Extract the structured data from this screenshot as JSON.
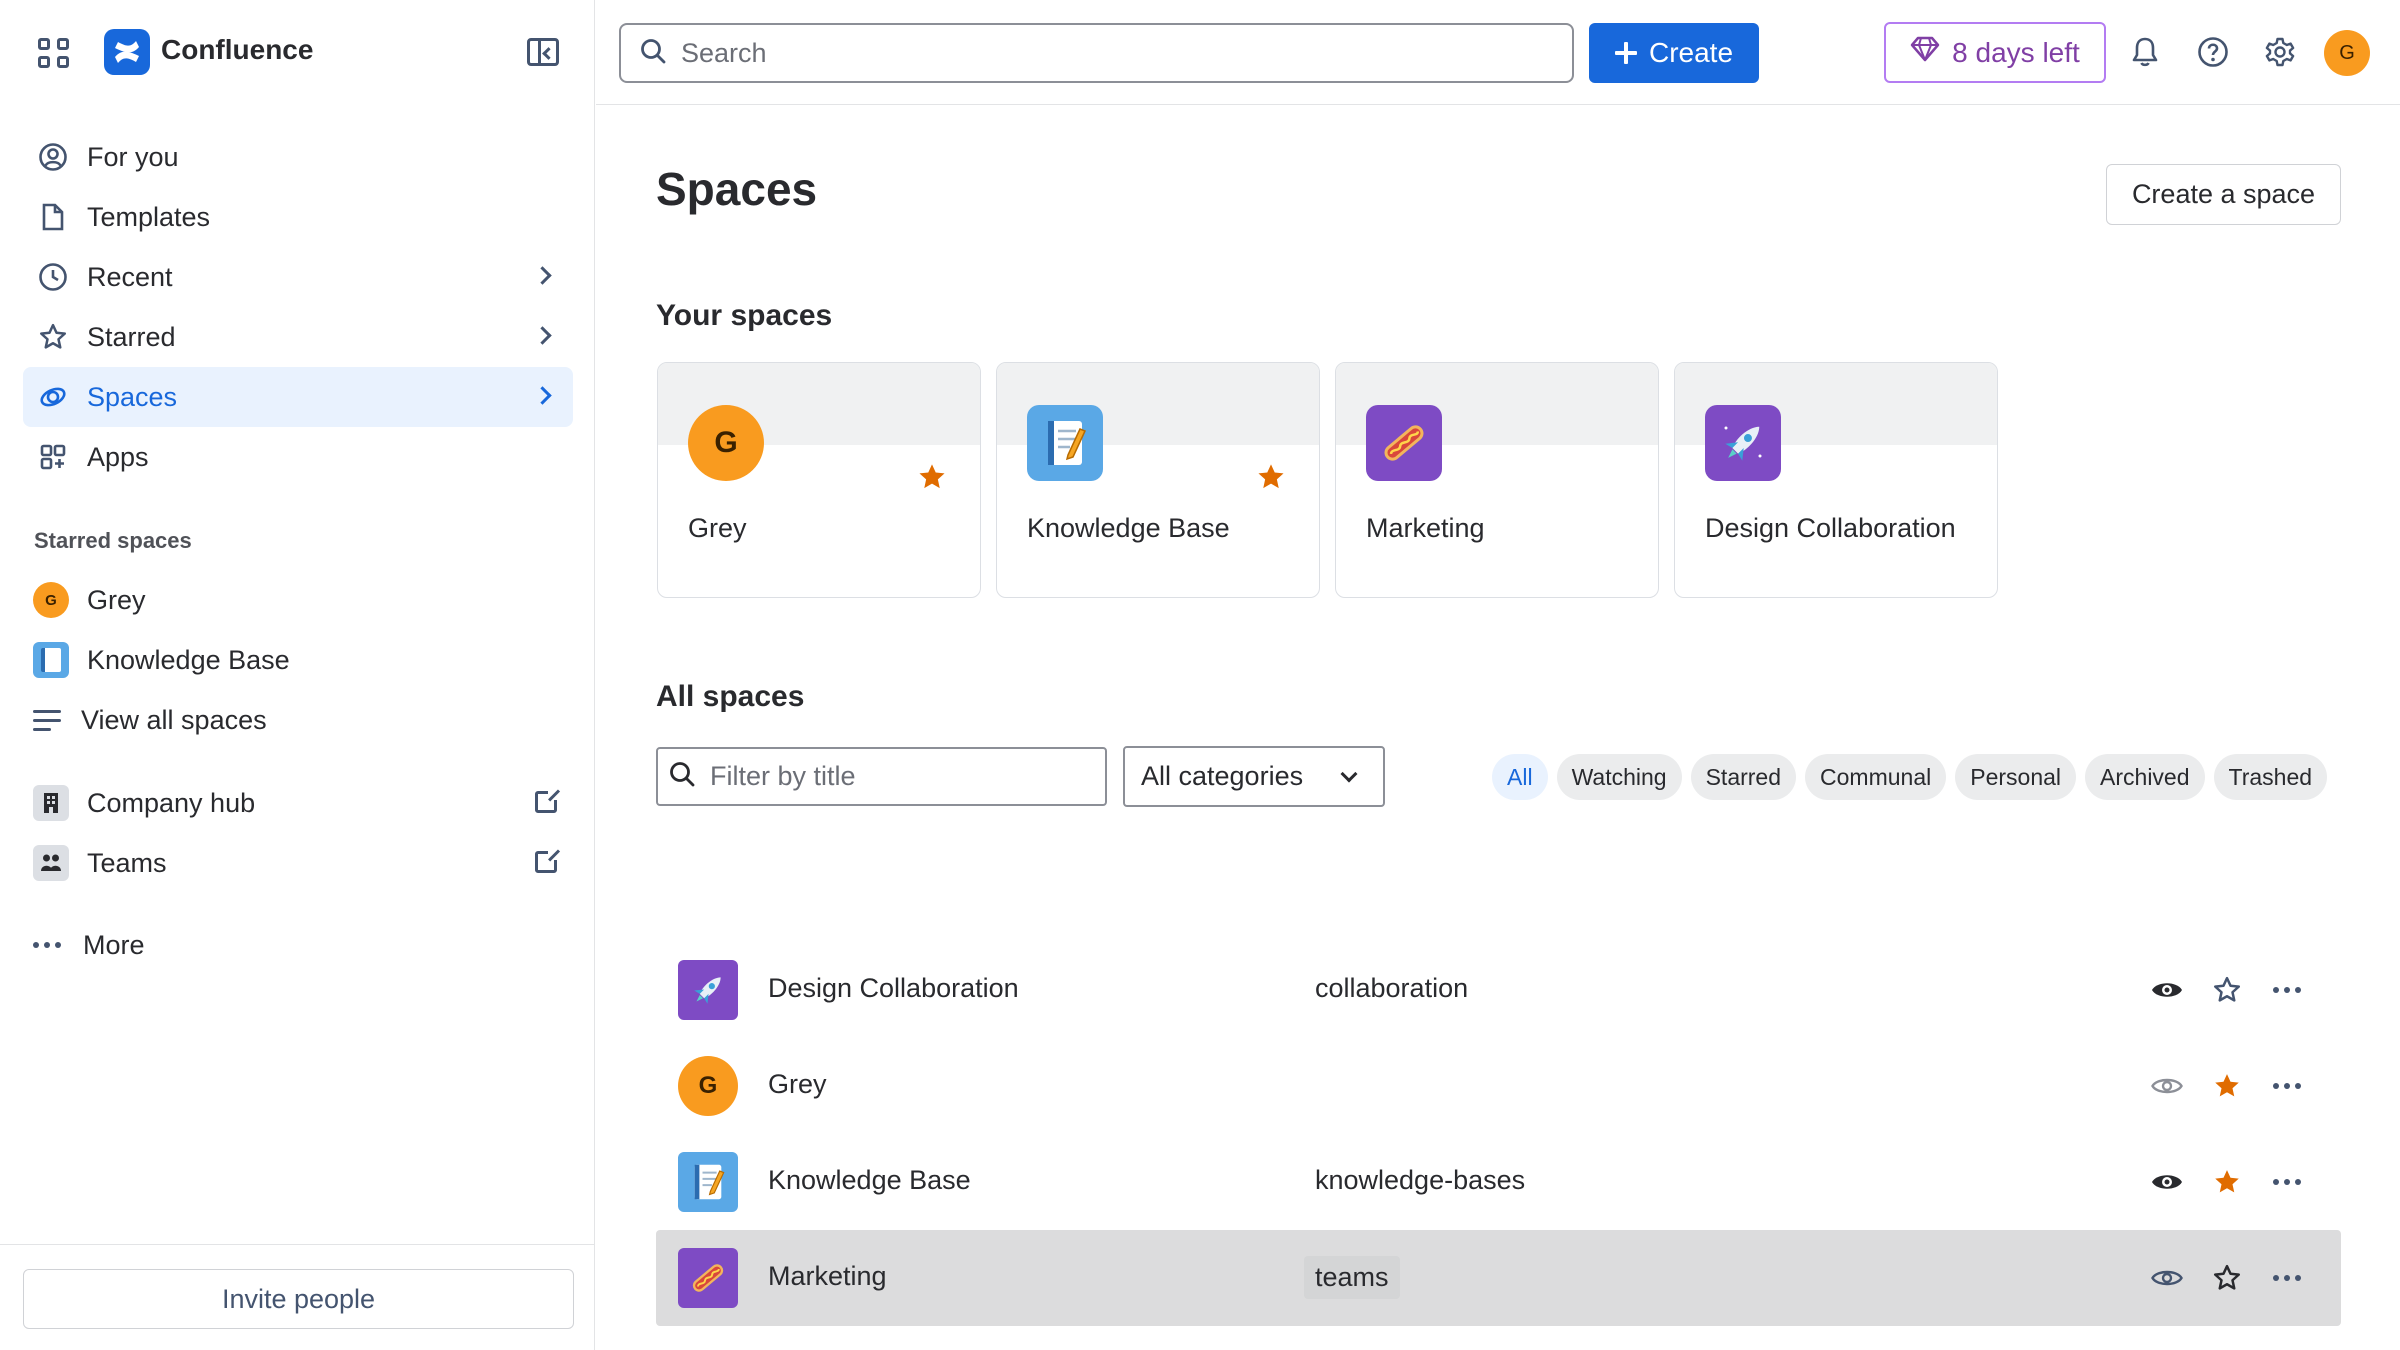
{
  "app": {
    "name": "Confluence"
  },
  "sidebar": {
    "nav": [
      {
        "label": "For you",
        "icon": "person-circle-icon"
      },
      {
        "label": "Templates",
        "icon": "templates-icon"
      },
      {
        "label": "Recent",
        "icon": "clock-icon",
        "has_chevron": true
      },
      {
        "label": "Starred",
        "icon": "star-outline-icon",
        "has_chevron": true
      },
      {
        "label": "Spaces",
        "icon": "spaces-icon",
        "has_chevron": true,
        "active": true
      },
      {
        "label": "Apps",
        "icon": "apps-icon"
      }
    ],
    "starred_label": "Starred spaces",
    "starred": [
      {
        "label": "Grey",
        "avatar_letter": "G"
      },
      {
        "label": "Knowledge Base"
      },
      {
        "label": "View all spaces"
      }
    ],
    "external": [
      {
        "label": "Company hub",
        "icon": "building-icon"
      },
      {
        "label": "Teams",
        "icon": "people-icon"
      }
    ],
    "more_label": "More",
    "invite_label": "Invite people"
  },
  "topbar": {
    "search_placeholder": "Search",
    "create_label": "Create",
    "trial_label": "8 days left",
    "user_initial": "G"
  },
  "main": {
    "title": "Spaces",
    "create_space_label": "Create a space",
    "your_spaces_heading": "Your spaces",
    "your_spaces": [
      {
        "name": "Grey",
        "icon": "avatar",
        "letter": "G",
        "starred": true
      },
      {
        "name": "Knowledge Base",
        "icon": "notebook-icon",
        "starred": true
      },
      {
        "name": "Marketing",
        "icon": "hotdog-icon",
        "starred": false
      },
      {
        "name": "Design Collaboration",
        "icon": "rocket-icon",
        "starred": false
      }
    ],
    "all_spaces_heading": "All spaces",
    "filter_placeholder": "Filter by title",
    "category_selected": "All categories",
    "chips": [
      "All",
      "Watching",
      "Starred",
      "Communal",
      "Personal",
      "Archived",
      "Trashed"
    ],
    "active_chip": "All",
    "rows": [
      {
        "name": "Design Collaboration",
        "key": "collaboration",
        "icon": "rocket-icon",
        "watching": true,
        "starred": false
      },
      {
        "name": "Grey",
        "key": "",
        "icon": "avatar",
        "letter": "G",
        "watching": false,
        "starred": true
      },
      {
        "name": "Knowledge Base",
        "key": "knowledge-bases",
        "icon": "notebook-icon",
        "watching": true,
        "starred": true
      },
      {
        "name": "Marketing",
        "key": "teams",
        "icon": "hotdog-icon",
        "watching": false,
        "starred": false,
        "highlighted": true
      }
    ]
  },
  "colors": {
    "brand": "#1868db",
    "active_bg": "#e9f2fe",
    "star": "#e06c00",
    "trial": "#803fa5",
    "avatar": "#f99b1f"
  }
}
